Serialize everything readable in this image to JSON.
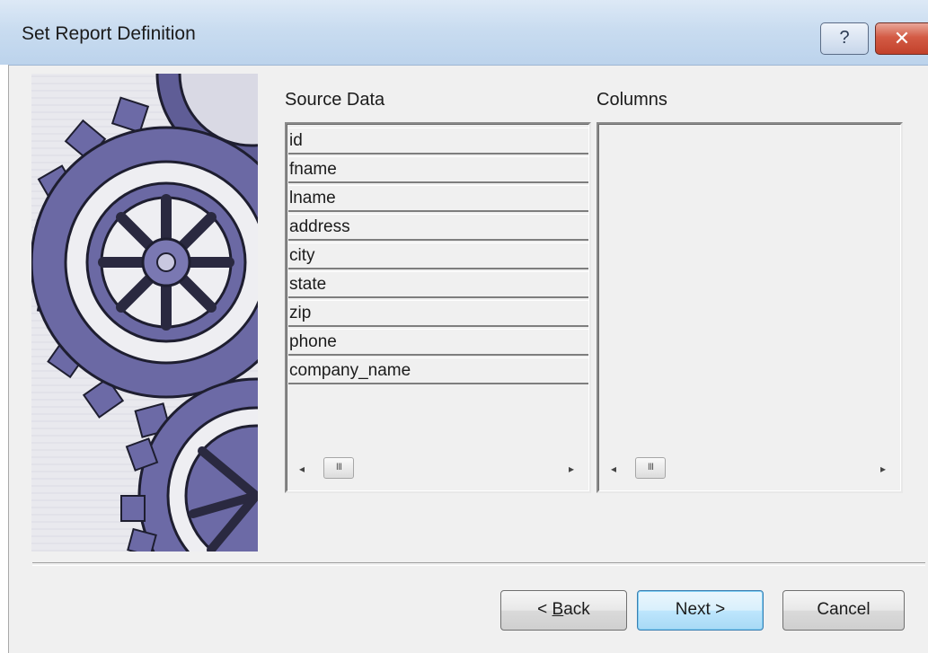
{
  "window": {
    "title": "Set Report Definition",
    "help_glyph": "?",
    "close_glyph": "✕"
  },
  "source": {
    "label": "Source Data",
    "items": [
      "id",
      "fname",
      "lname",
      "address",
      "city",
      "state",
      "zip",
      "phone",
      "company_name"
    ]
  },
  "columns": {
    "label": "Columns",
    "items": []
  },
  "scroll": {
    "left_arrow": "◂",
    "right_arrow": "▸",
    "thumb_grip": "III"
  },
  "buttons": {
    "back_pre": "< ",
    "back_mnemonic": "B",
    "back_post": "ack",
    "next": "Next >",
    "cancel": "Cancel"
  },
  "icons": {
    "help": "help-icon",
    "close": "close-icon",
    "illustration": "gears-illustration"
  }
}
